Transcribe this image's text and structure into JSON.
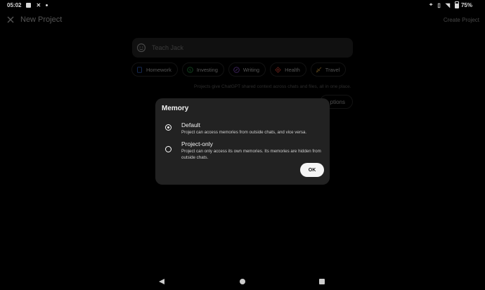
{
  "status_bar": {
    "time": "05:02",
    "battery": "75%"
  },
  "header": {
    "title": "New Project",
    "create_label": "Create Project"
  },
  "name_field": {
    "placeholder": "Teach Jack"
  },
  "chips": [
    {
      "label": "Homework",
      "icon": "notebook-icon",
      "color": "#3b6fd8"
    },
    {
      "label": "Investing",
      "icon": "dollar-icon",
      "color": "#2ea84f"
    },
    {
      "label": "Writing",
      "icon": "pen-icon",
      "color": "#9b59e8"
    },
    {
      "label": "Health",
      "icon": "health-icon",
      "color": "#e04a3a"
    },
    {
      "label": "Travel",
      "icon": "plane-icon",
      "color": "#d9a441"
    }
  ],
  "hint_text": "Projects give ChatGPT shared context across chats and files, all in one place.",
  "options_button": "ptions",
  "dialog": {
    "title": "Memory",
    "options": [
      {
        "title": "Default",
        "description": "Project can access memories from outside chats, and vice versa.",
        "selected": true
      },
      {
        "title": "Project-only",
        "description": "Project can only access its own memories. Its memories are hidden from outside chats.",
        "selected": false
      }
    ],
    "ok_label": "OK"
  }
}
